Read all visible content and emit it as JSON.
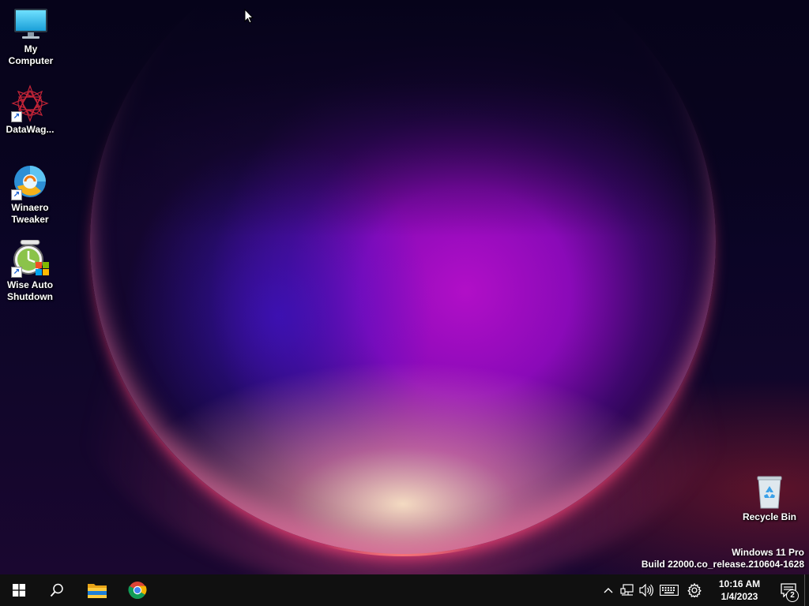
{
  "desktop": {
    "icons": [
      {
        "label": "My\nComputer",
        "icon": "monitor-icon",
        "shortcut": false
      },
      {
        "label": "DataWag...",
        "icon": "datawag-icon",
        "shortcut": true
      },
      {
        "label": "Winaero\nTweaker",
        "icon": "winaero-tweaker-icon",
        "shortcut": true
      },
      {
        "label": "Wise Auto\nShutdown",
        "icon": "wise-auto-shutdown-icon",
        "shortcut": true
      }
    ],
    "recycle_bin": {
      "label": "Recycle Bin",
      "icon": "recycle-bin-icon"
    },
    "watermark": {
      "line1": "Windows 11 Pro",
      "line2": "Build 22000.co_release.210604-1628"
    }
  },
  "taskbar": {
    "start": {
      "icon": "windows-logo-icon"
    },
    "search": {
      "icon": "search-icon"
    },
    "pinned": [
      {
        "name": "File Explorer",
        "icon": "folder-icon"
      },
      {
        "name": "Google Chrome",
        "icon": "chrome-icon"
      }
    ],
    "tray": {
      "icons": [
        "chevron-up-icon",
        "network-icon",
        "volume-icon",
        "keyboard-icon",
        "gear-icon"
      ],
      "time": "10:16 AM",
      "date": "1/4/2023",
      "notification_count": "2"
    }
  },
  "colors": {
    "taskbar": "#101010",
    "desktop_base": "#07041c",
    "orb_purple": "#b10fc7",
    "orb_rim": "#ff3a7a"
  }
}
